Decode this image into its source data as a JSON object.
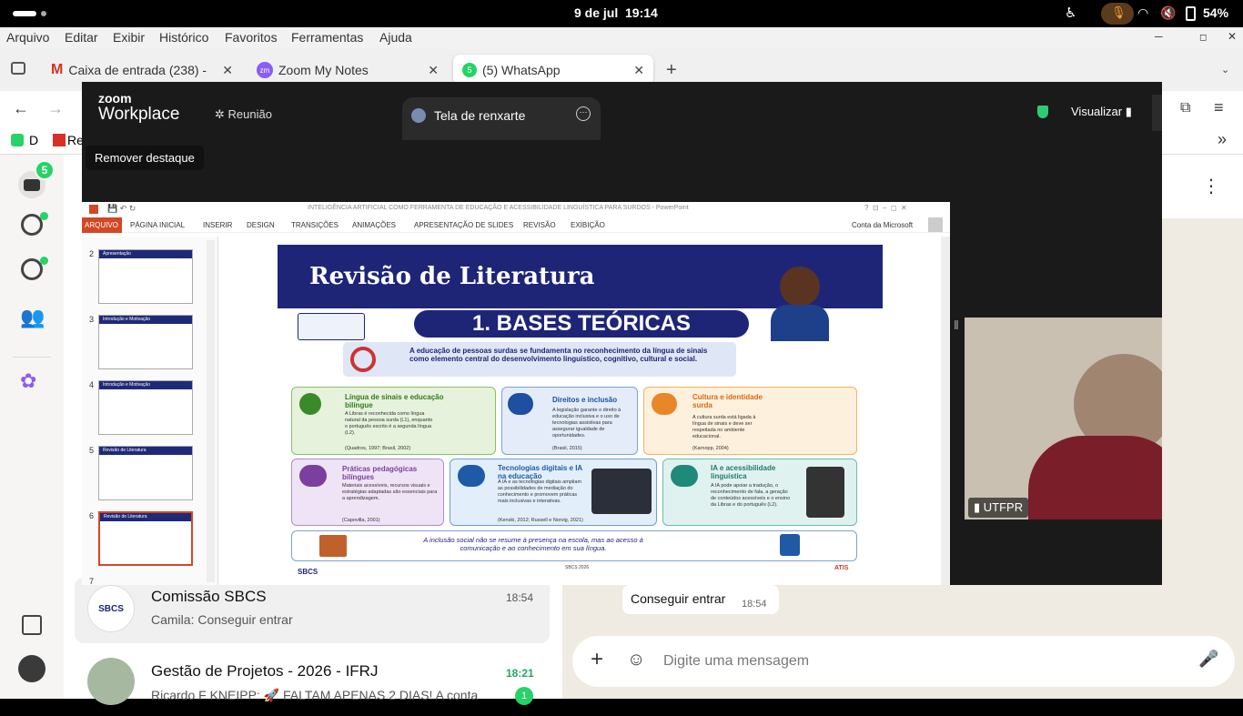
{
  "system": {
    "date": "9 de jul",
    "time": "19:14",
    "battery": "54%"
  },
  "menu": [
    "Arquivo",
    "Editar",
    "Exibir",
    "Histórico",
    "Favoritos",
    "Ferramentas",
    "Ajuda"
  ],
  "tabs": [
    {
      "label": "Caixa de entrada (238) -",
      "icon": "gmail-icon"
    },
    {
      "label": "Zoom My Notes",
      "icon": "zoom-icon"
    },
    {
      "label": "(5) WhatsApp",
      "icon": "whatsapp-icon"
    }
  ],
  "bookmarks": [
    "D",
    "Re"
  ],
  "zoom": {
    "brand1": "zoom",
    "brand2": "Workplace",
    "meeting_tab": "Reunião",
    "share_tab": "Tela de renxarte",
    "view_button": "Visualizar",
    "tooltip": "Remover destaque",
    "participant_name": "UTFPR"
  },
  "ppt": {
    "title": "INTELIGÊNCIA ARTIFICIAL COMO FERRAMENTA DE EDUCAÇÃO E ACESSIBILIDADE LINGUÍSTICA PARA SURDOS - PowerPoint",
    "account": "Conta da Microsoft",
    "ribbon": [
      "ARQUIVO",
      "PÁGINA INICIAL",
      "INSERIR",
      "DESIGN",
      "TRANSIÇÕES",
      "ANIMAÇÕES",
      "APRESENTAÇÃO DE SLIDES",
      "REVISÃO",
      "EXIBIÇÃO"
    ],
    "thumbs": [
      {
        "n": "2",
        "title": "Apresentação"
      },
      {
        "n": "3",
        "title": "Introdução e Motivação"
      },
      {
        "n": "4",
        "title": "Introdução e Motivação"
      },
      {
        "n": "5",
        "title": "Revisão de Literatura"
      },
      {
        "n": "6",
        "title": "Revisão de Literatura"
      },
      {
        "n": "7",
        "title": ""
      }
    ],
    "slide": {
      "header": "Revisão de Literatura",
      "banner": "1. BASES TEÓRICAS",
      "intro": "A educação de pessoas surdas se fundamenta no reconhecimento da língua de sinais como elemento central do desenvolvimento linguístico, cognitivo, cultural e social.",
      "cards": [
        {
          "title": "Língua de sinais e educação bilíngue",
          "body": "A Libras é reconhecida como língua natural da pessoa surda (L1), enquanto o português escrito é a segunda língua (L2).",
          "ref": "(Quadros, 1997; Brasil, 2002)"
        },
        {
          "title": "Direitos e inclusão",
          "body": "A legislação garante o direito à educação inclusiva e o uso de tecnologias assistivas para assegurar igualdade de oportunidades.",
          "ref": "(Brasil, 2015)"
        },
        {
          "title": "Cultura e identidade surda",
          "body": "A cultura surda está ligada à língua de sinais e deve ser respeitada no ambiente educacional.",
          "ref": "(Karnopp, 2004)"
        },
        {
          "title": "Práticas pedagógicas bilíngues",
          "body": "Materiais acessíveis, recursos visuais e estratégias adaptadas são essenciais para a aprendizagem.",
          "ref": "(Capovilla, 2001)"
        },
        {
          "title": "Tecnologias digitais e IA na educação",
          "body": "A IA e as tecnologias digitais ampliam as possibilidades de mediação do conhecimento e promovem práticas mais inclusivas e interativas.",
          "ref": "(Kenski, 2012; Russell e Norvig, 2021)"
        },
        {
          "title": "IA e acessibilidade linguística",
          "body": "A IA pode apoiar a tradução, o reconhecimento de fala, a geração de conteúdos acessíveis e o ensino da Libras e do português (L2).",
          "ref": ""
        }
      ],
      "quote": "A inclusão social não se resume à presença na escola, mas ao acesso à comunicação e ao conhecimento em sua língua.",
      "footer_center": "SBCS 2026",
      "footer_left": "SBCS",
      "footer_right": "ATIS"
    }
  },
  "whatsapp": {
    "badge": "5",
    "chats": [
      {
        "name": "Comissão SBCS",
        "preview": "Camila: Conseguir entrar",
        "time": "18:54",
        "avatar": "SBCS"
      },
      {
        "name": "Gestão de Projetos - 2026 - IFRJ",
        "preview": "Ricardo F KNEIPP: 🚀 FALTAM APENAS 2 DIAS! A conta",
        "time": "18:21",
        "unread": "1"
      }
    ],
    "message": {
      "text": "Conseguir entrar",
      "time": "18:54"
    },
    "composer_placeholder": "Digite uma mensagem"
  },
  "colors": {
    "slide_navy": "#1e2577",
    "wa_green": "#25d366",
    "ppt_red": "#d24726"
  }
}
